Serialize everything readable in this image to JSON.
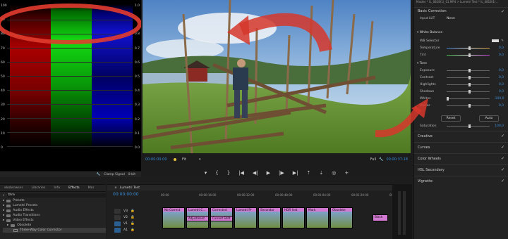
{
  "scopes": {
    "left_scale": [
      "100",
      "90",
      "80",
      "70",
      "60",
      "50",
      "40",
      "30",
      "20",
      "10",
      "0"
    ],
    "right_scale": [
      "1.0",
      "0.9",
      "0.8",
      "0.7",
      "0.6",
      "0.5",
      "0.4",
      "0.3",
      "0.2",
      "0.1",
      "0.0"
    ],
    "footer": {
      "clamp": "Clamp Signal",
      "mode": "8 bit"
    }
  },
  "monitor": {
    "timecode_left": "00:00:00:00",
    "fit": "Fit",
    "quality": "Full",
    "timecode_right": "00:00:37:18"
  },
  "lumetri": {
    "header": "Master * IL_0818(1)_01.MP4 > Lumetri Test * IL_0818(1)...",
    "basic_correction": "Basic Correction",
    "input_lut": {
      "label": "Input LUT",
      "value": "None"
    },
    "white_balance": "White Balance",
    "wb_selector": "WB Selector",
    "rows": [
      {
        "label": "Temperature",
        "value": "0,0",
        "level": 0.5
      },
      {
        "label": "Tint",
        "value": "0,0",
        "level": 0.5
      }
    ],
    "tone": "Tone",
    "tone_rows": [
      {
        "label": "Exposure",
        "value": "0,0",
        "level": 0.5
      },
      {
        "label": "Contrast",
        "value": "0,0",
        "level": 0.5
      },
      {
        "label": "Highlights",
        "value": "0,0",
        "level": 0.5
      },
      {
        "label": "Shadows",
        "value": "0,0",
        "level": 0.5
      },
      {
        "label": "Whites",
        "value": "-100,0",
        "level": 0.0
      },
      {
        "label": "Blacks",
        "value": "0,0",
        "level": 0.5
      }
    ],
    "reset": "Reset",
    "auto": "Auto",
    "saturation": {
      "label": "Saturation",
      "value": "100,0"
    },
    "sections": [
      "Creative",
      "Curves",
      "Color Wheels",
      "HSL Secondary",
      "Vignette"
    ]
  },
  "project": {
    "tabs": [
      "ekobrowser",
      "Libraries",
      "Info",
      "Effects",
      "Mar"
    ],
    "active_tab": "Effects",
    "search": "thre",
    "items": [
      "Presets",
      "Lumetri Presets",
      "Audio Effects",
      "Audio Transitions",
      "Video Effects",
      "Obsolete",
      "Three-Way Color Corrector"
    ]
  },
  "timeline": {
    "title": "Lumetri Test",
    "timecode": "00:00:00:00",
    "ruler": [
      "00:00",
      "00:00:16:00",
      "00:00:32:00",
      "00:00:48:00",
      "00:01:04:00",
      "00:01:20:00",
      "00:01:36:00"
    ],
    "tracks": [
      "V3",
      "V2",
      "V1",
      "A1"
    ],
    "clips_top": [
      "No Correct",
      "Lumetri C...",
      "Corrected",
      "Lumetri Pr",
      "Secondar",
      "HDR Inst",
      "Mark",
      "Obsolete"
    ],
    "clips_mid": [
      "Adjustment",
      "Current Shift"
    ],
    "end_clip": "Black"
  }
}
